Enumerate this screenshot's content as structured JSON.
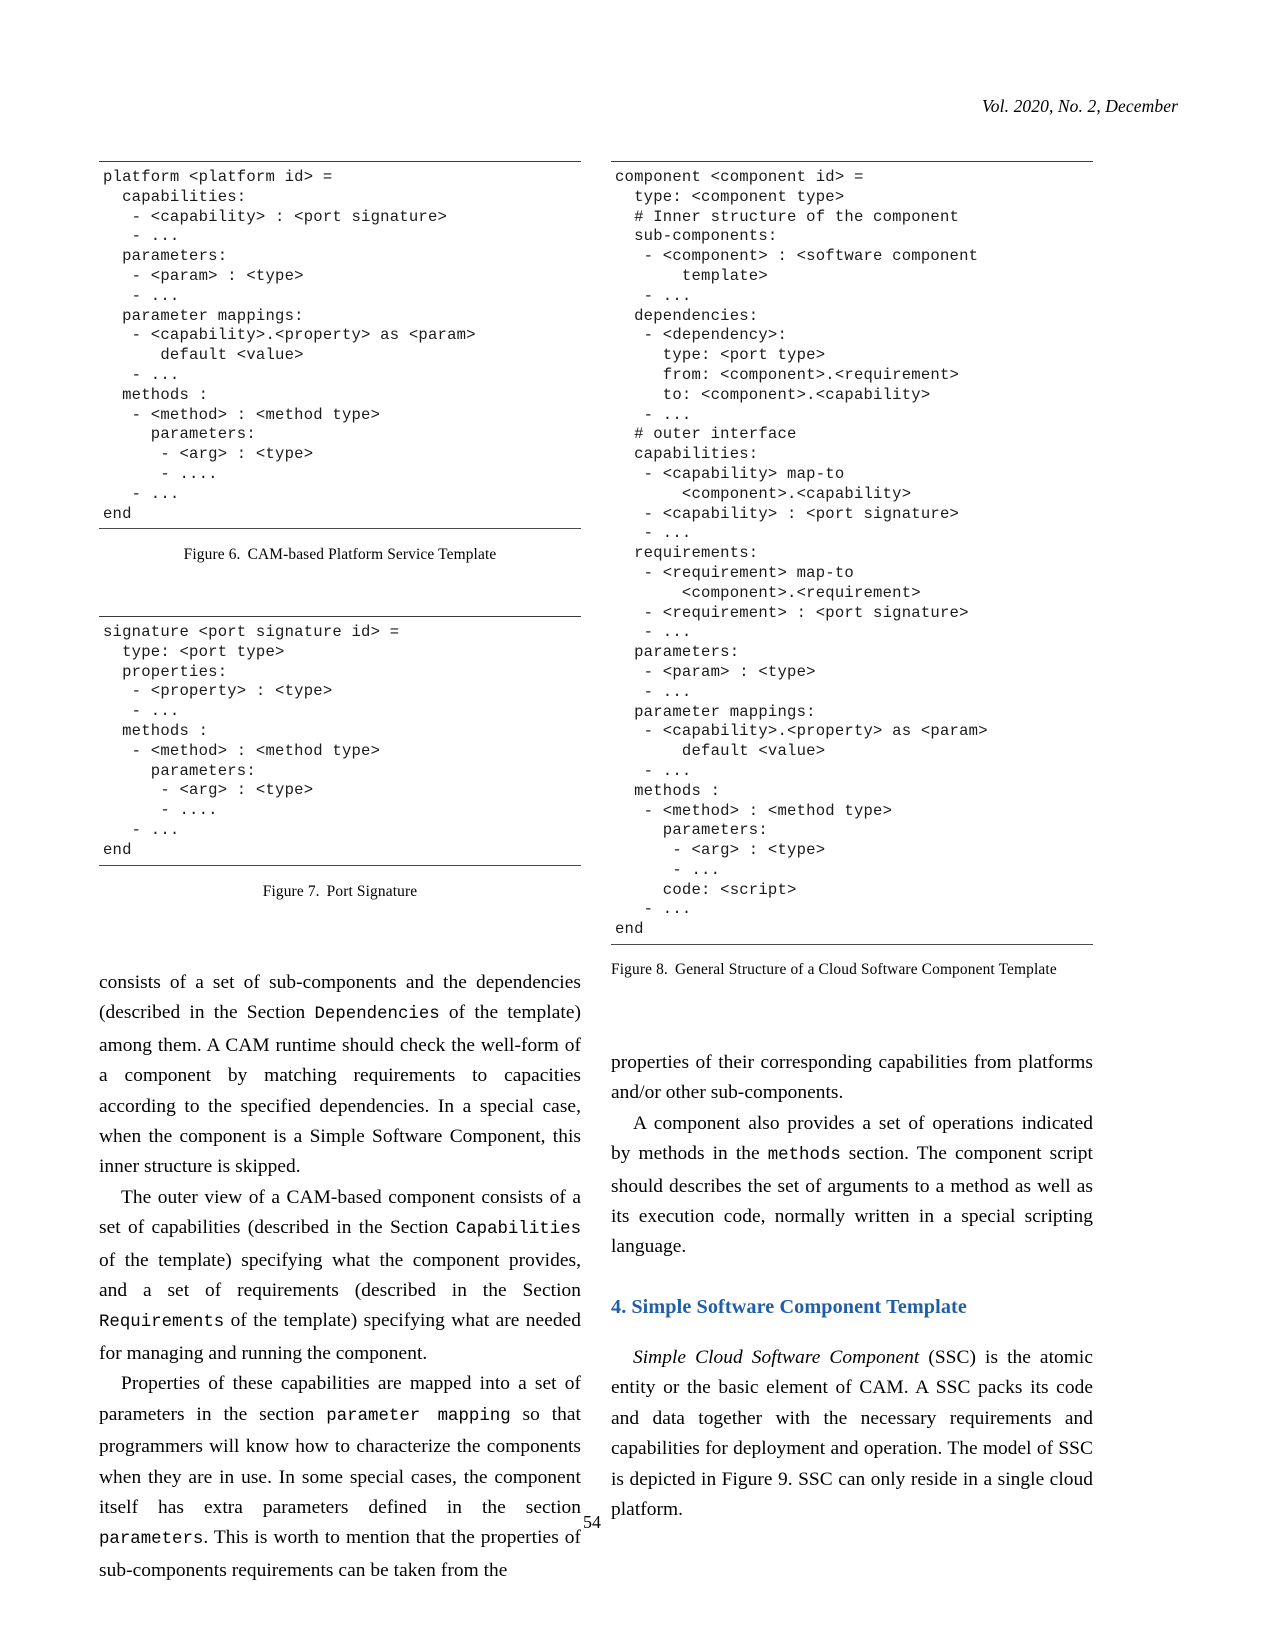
{
  "running_head": "Vol. 2020, No. 2, December",
  "page_number": "54",
  "figures": {
    "fig6": {
      "code": "platform <platform id> =\n  capabilities:\n   - <capability> : <port signature>\n   - ...\n  parameters:\n   - <param> : <type>\n   - ...\n  parameter mappings:\n   - <capability>.<property> as <param>\n      default <value>\n   - ...\n  methods :\n   - <method> : <method type>\n     parameters:\n      - <arg> : <type>\n      - ....\n   - ...\nend",
      "caption_number": "Figure 6.",
      "caption_text": "CAM-based Platform Service Template"
    },
    "fig7": {
      "code": "signature <port signature id> =\n  type: <port type>\n  properties:\n   - <property> : <type>\n   - ...\n  methods :\n   - <method> : <method type>\n     parameters:\n      - <arg> : <type>\n      - ....\n   - ...\nend",
      "caption_number": "Figure 7.",
      "caption_text": "Port Signature"
    },
    "fig8": {
      "code": "component <component id> =\n  type: <component type>\n  # Inner structure of the component\n  sub-components:\n   - <component> : <software component\n       template>\n   - ...\n  dependencies:\n   - <dependency>:\n     type: <port type>\n     from: <component>.<requirement>\n     to: <component>.<capability>\n   - ...\n  # outer interface\n  capabilities:\n   - <capability> map-to\n       <component>.<capability>\n   - <capability> : <port signature>\n   - ...\n  requirements:\n   - <requirement> map-to\n       <component>.<requirement>\n   - <requirement> : <port signature>\n   - ...\n  parameters:\n   - <param> : <type>\n   - ...\n  parameter mappings:\n   - <capability>.<property> as <param>\n       default <value>\n   - ...\n  methods :\n   - <method> : <method type>\n     parameters:\n      - <arg> : <type>\n      - ...\n     code: <script>\n   - ...\nend",
      "caption_number": "Figure 8.",
      "caption_text": "General Structure of a Cloud Software Component Template"
    }
  },
  "left_column": {
    "para1": {
      "part1": "consists of a set of sub-components and the dependencies (described in the Section ",
      "code1": "Dependencies",
      "part2": " of the template) among them. A CAM runtime should check the well-form of a component by matching requirements to capacities according to the specified dependencies. In a special case, when the component is a Simple Software Component, this inner structure is skipped."
    },
    "para2": {
      "part1": "The outer view of a CAM-based component consists of a set of capabilities (described in the Section ",
      "code1": "Capabilities",
      "part2": " of the template) specifying what the component provides, and a set of requirements (described in the Section ",
      "code2": "Requirements",
      "part3": " of the template) specifying what are needed for managing and running the component."
    },
    "para3": {
      "part1": "Properties of these capabilities are mapped into a set of parameters in the section ",
      "code1": "parameter mapping",
      "part2": " so that programmers will know how to characterize the components when they are in use. In some special cases, the component itself has extra parameters defined in the section ",
      "code2": "parameters",
      "part3": ". This is worth to mention that the properties of sub-components requirements can be taken from the"
    }
  },
  "right_column": {
    "para1": "properties of their corresponding capabilities from platforms and/or other sub-components.",
    "para2": {
      "part1": "A component also provides a set of operations indicated by methods in the ",
      "code1": "methods",
      "part2": " section. The component script should describes the set of arguments to a method as well as its execution code, normally written in a special scripting language."
    },
    "section": {
      "number": "4.",
      "title": "Simple Software Component Template"
    },
    "para3": {
      "italic1": "Simple Cloud Software Component",
      "part1": " (SSC) is the atomic entity or the basic element of CAM. A SSC packs its code and data together with the necessary requirements and capabilities for deployment and operation. The model of SSC is depicted in Figure 9. SSC can only reside in a single cloud platform."
    }
  }
}
